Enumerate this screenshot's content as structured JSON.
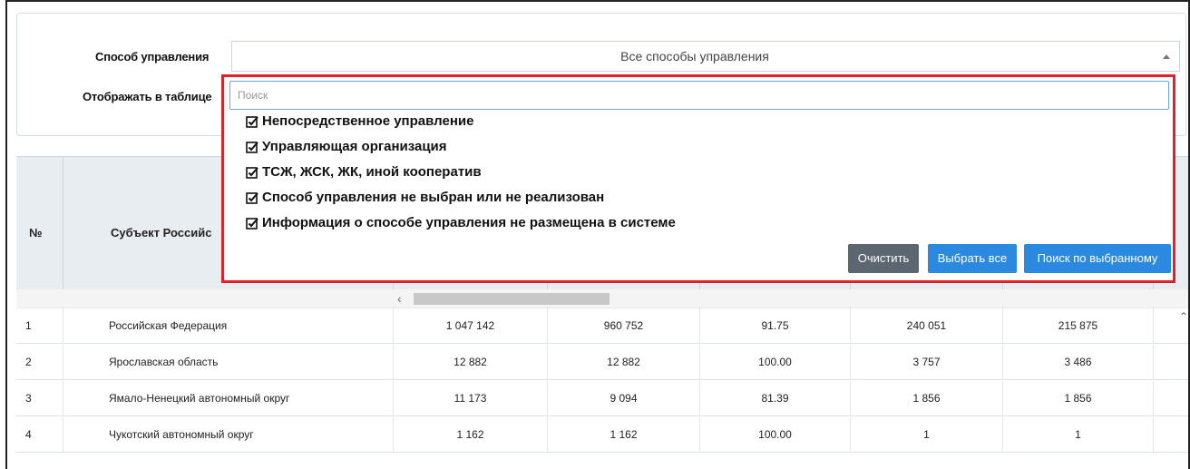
{
  "filters": {
    "management_label": "Способ управления",
    "display_label": "Отображать в таблице",
    "management_value": "Все способы управления"
  },
  "dropdown": {
    "search_placeholder": "Поиск",
    "options": [
      {
        "label": "Непосредственное управление",
        "checked": true
      },
      {
        "label": "Управляющая организация",
        "checked": true
      },
      {
        "label": "ТСЖ, ЖСК, ЖК, иной кооператив",
        "checked": true
      },
      {
        "label": "Способ управления не выбран или не реализован",
        "checked": true
      },
      {
        "label": "Информация о способе управления не размещена в системе",
        "checked": true
      }
    ],
    "clear_label": "Очистить",
    "select_all_label": "Выбрать все",
    "search_selected_label": "Поиск по выбранному"
  },
  "table": {
    "col_num_header": "№",
    "col_subject_header": "Субъект Российс",
    "rows": [
      {
        "num": "1",
        "name": "Российская Федерация",
        "v1": "1 047 142",
        "v2": "960 752",
        "v3": "91.75",
        "v4": "240 051",
        "v5": "215 875"
      },
      {
        "num": "2",
        "name": "Ярославская область",
        "v1": "12 882",
        "v2": "12 882",
        "v3": "100.00",
        "v4": "3 757",
        "v5": "3 486"
      },
      {
        "num": "3",
        "name": "Ямало-Ненецкий автономный округ",
        "v1": "11 173",
        "v2": "9 094",
        "v3": "81.39",
        "v4": "1 856",
        "v5": "1 856"
      },
      {
        "num": "4",
        "name": "Чукотский автономный округ",
        "v1": "1 162",
        "v2": "1 162",
        "v3": "100.00",
        "v4": "1",
        "v5": "1"
      }
    ]
  },
  "colors": {
    "highlight_border": "#e0202a",
    "primary_button": "#2b8ae0",
    "secondary_button": "#5b6670",
    "header_bg": "#e8edf2"
  }
}
